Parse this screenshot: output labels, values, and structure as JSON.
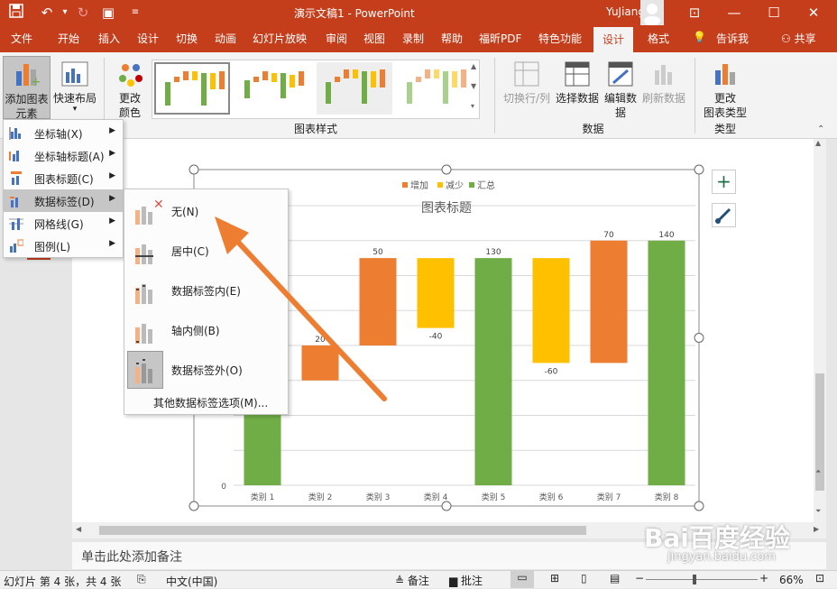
{
  "window": {
    "doc_title": "演示文稿1",
    "sep": "-",
    "app": "PowerPoint",
    "user": "YuJiang Li"
  },
  "tabs": [
    "文件",
    "开始",
    "插入",
    "设计",
    "切换",
    "动画",
    "幻灯片放映",
    "审阅",
    "视图",
    "录制",
    "帮助",
    "福昕PDF",
    "特色功能",
    "设计",
    "格式"
  ],
  "tell_me": "告诉我",
  "share": "共享",
  "ribbon": {
    "add_element_1": "添加图表",
    "add_element_2": "元素",
    "quick_layout": "快速布局",
    "change_colors_1": "更改",
    "change_colors_2": "颜色",
    "switch_rowcol": "切换行/列",
    "select_data": "选择数据",
    "edit_data_1": "编辑数",
    "edit_data_2": "据",
    "refresh_data": "刷新数据",
    "change_type_1": "更改",
    "change_type_2": "图表类型",
    "group_styles": "图表样式",
    "group_data": "数据",
    "group_type": "类型"
  },
  "menu": {
    "items": [
      "坐标轴(X)",
      "坐标轴标题(A)",
      "图表标题(C)",
      "数据标签(D)",
      "网格线(G)",
      "图例(L)"
    ]
  },
  "submenu": {
    "items": [
      "无(N)",
      "居中(C)",
      "数据标签内(E)",
      "轴内侧(B)",
      "数据标签外(O)"
    ],
    "more": "其他数据标签选项(M)..."
  },
  "chart_data": {
    "type": "bar",
    "title": "图表标题",
    "categories": [
      "类别 1",
      "类别 2",
      "类别 3",
      "类别 4",
      "类别 5",
      "类别 6",
      "类别 7",
      "类别 8"
    ],
    "bars": [
      {
        "base": 0,
        "top": 80,
        "kind": "汇总",
        "label": ""
      },
      {
        "base": 60,
        "top": 80,
        "kind": "增加",
        "label": "20"
      },
      {
        "base": 80,
        "top": 130,
        "kind": "增加",
        "label": "50"
      },
      {
        "base": 90,
        "top": 130,
        "kind": "减少",
        "label": "-40"
      },
      {
        "base": 0,
        "top": 130,
        "kind": "汇总",
        "label": "130"
      },
      {
        "base": 70,
        "top": 130,
        "kind": "减少",
        "label": "-60"
      },
      {
        "base": 70,
        "top": 140,
        "kind": "增加",
        "label": "70"
      },
      {
        "base": 0,
        "top": 140,
        "kind": "汇总",
        "label": "140"
      }
    ],
    "legend": [
      "增加",
      "减少",
      "汇总"
    ],
    "colors": {
      "增加": "#ed7d31",
      "减少": "#ffc000",
      "汇总": "#70ad47"
    },
    "ylim": [
      0,
      160
    ],
    "yticks": [
      "0"
    ],
    "legend_position": "top"
  },
  "notes": "单击此处添加备注",
  "status": {
    "slide": "幻灯片 第 4 张，共 4 张",
    "lang": "中文(中国)",
    "notes": "备注",
    "comments": "批注",
    "zoom": "66%"
  },
  "watermark": {
    "brand": "Bai百度经验",
    "url": "jingyan.baidu.com"
  }
}
